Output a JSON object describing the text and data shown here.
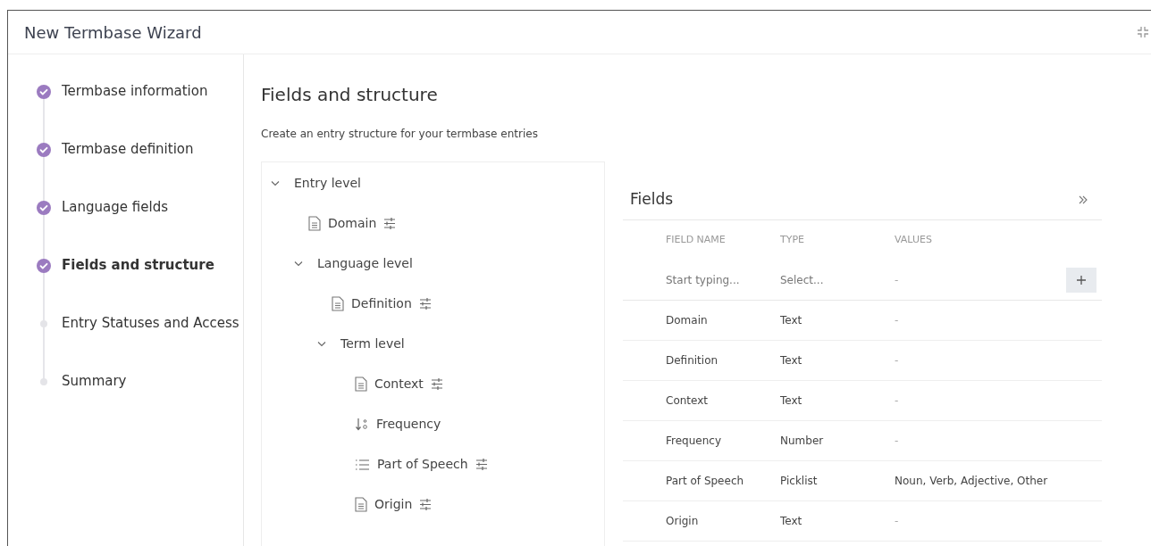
{
  "window": {
    "title": "New Termbase Wizard"
  },
  "steps": [
    {
      "label": "Termbase information",
      "completed": true,
      "selected": false
    },
    {
      "label": "Termbase definition",
      "completed": true,
      "selected": false
    },
    {
      "label": "Language fields",
      "completed": true,
      "selected": false
    },
    {
      "label": "Fields and structure",
      "completed": true,
      "selected": true
    },
    {
      "label": "Entry Statuses and Access",
      "completed": false,
      "selected": false
    },
    {
      "label": "Summary",
      "completed": false,
      "selected": false
    }
  ],
  "page": {
    "title": "Fields and structure",
    "subtitle": "Create an entry structure for your termbase entries"
  },
  "tree": [
    {
      "kind": "level",
      "label": "Entry level",
      "expanded": true,
      "children": [
        {
          "kind": "text_field",
          "label": "Domain",
          "options": true
        },
        {
          "kind": "level",
          "label": "Language level",
          "expanded": true,
          "children": [
            {
              "kind": "text_field",
              "label": "Definition",
              "options": true
            },
            {
              "kind": "level",
              "label": "Term level",
              "expanded": true,
              "children": [
                {
                  "kind": "text_field",
                  "label": "Context",
                  "options": true
                },
                {
                  "kind": "number_field",
                  "label": "Frequency",
                  "options": false
                },
                {
                  "kind": "picklist_field",
                  "label": "Part of Speech",
                  "options": true
                },
                {
                  "kind": "text_field",
                  "label": "Origin",
                  "options": true
                }
              ]
            }
          ]
        }
      ]
    }
  ],
  "fields_panel": {
    "title": "Fields",
    "columns": [
      "FIELD NAME",
      "TYPE",
      "VALUES"
    ],
    "new_row": {
      "name_placeholder": "Start typing...",
      "type_placeholder": "Select...",
      "values": "-"
    },
    "rows": [
      {
        "name": "Domain",
        "type": "Text",
        "values": "-"
      },
      {
        "name": "Definition",
        "type": "Text",
        "values": "-"
      },
      {
        "name": "Context",
        "type": "Text",
        "values": "-"
      },
      {
        "name": "Frequency",
        "type": "Number",
        "values": "-"
      },
      {
        "name": "Part of Speech",
        "type": "Picklist",
        "values": "Noun, Verb, Adjective, Other"
      },
      {
        "name": "Origin",
        "type": "Text",
        "values": "-"
      }
    ]
  }
}
